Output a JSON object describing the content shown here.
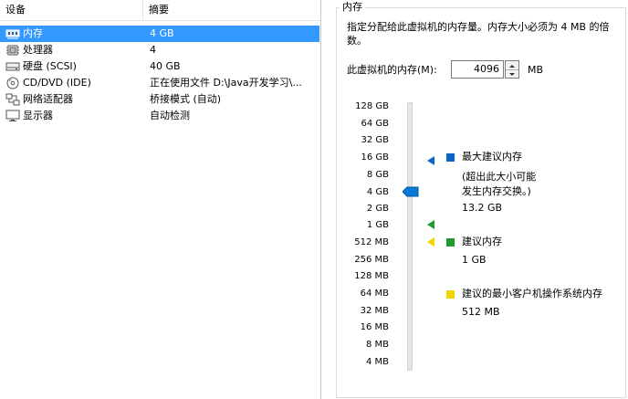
{
  "device_table": {
    "headers": {
      "device": "设备",
      "summary": "摘要"
    },
    "rows": [
      {
        "name": "内存",
        "summary": "4 GB",
        "icon": "memory-icon"
      },
      {
        "name": "处理器",
        "summary": "4",
        "icon": "cpu-icon"
      },
      {
        "name": "硬盘 (SCSI)",
        "summary": "40 GB",
        "icon": "harddisk-icon"
      },
      {
        "name": "CD/DVD (IDE)",
        "summary": "正在使用文件 D:\\Java开发学习\\...",
        "icon": "cd-icon"
      },
      {
        "name": "网络适配器",
        "summary": "桥接模式 (自动)",
        "icon": "network-icon"
      },
      {
        "name": "显示器",
        "summary": "自动检测",
        "icon": "display-icon"
      }
    ],
    "selected_index": 0
  },
  "memory_panel": {
    "title": "内存",
    "description": "指定分配给此虚拟机的内存量。内存大小必须为 4 MB 的倍数。",
    "label": "此虚拟机的内存(M):",
    "value": "4096",
    "unit": "MB",
    "scale": [
      "128 GB",
      "64 GB",
      "32 GB",
      "16 GB",
      "8 GB",
      "4 GB",
      "2 GB",
      "1 GB",
      "512 MB",
      "256 MB",
      "128 MB",
      "64 MB",
      "32 MB",
      "16 MB",
      "8 MB",
      "4 MB"
    ],
    "legend": {
      "max": {
        "title": "最大建议内存",
        "note1": "(超出此大小可能",
        "note2": "发生内存交换。)",
        "value": "13.2 GB",
        "color": "#0a64c8"
      },
      "recommended": {
        "title": "建议内存",
        "value": "1 GB",
        "color": "#1e9a2e"
      },
      "min_guest": {
        "title": "建议的最小客户机操作系统内存",
        "value": "512 MB",
        "color": "#f2d400"
      }
    }
  }
}
